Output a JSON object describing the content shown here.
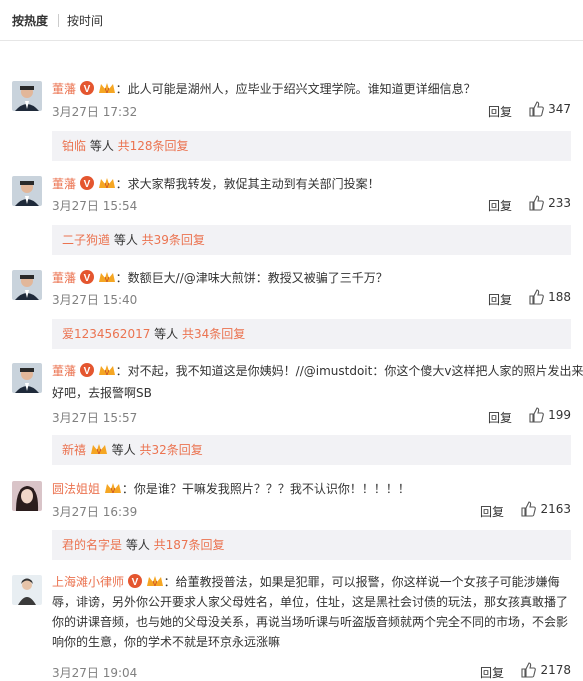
{
  "sort": {
    "hot": "按热度",
    "time": "按时间"
  },
  "comments": [
    {
      "user": "董藩",
      "text": "：此人可能是湖州人，应毕业于绍兴文理学院。谁知道更详细信息？",
      "time": "3月27日 17:32",
      "reply": "回复",
      "likes": "347",
      "sub": {
        "user": "铂临",
        "mid": " 等人 ",
        "count": "共128条回复"
      }
    },
    {
      "user": "董藩",
      "text": "：求大家帮我转发，敦促其主动到有关部门投案！",
      "time": "3月27日 15:54",
      "reply": "回复",
      "likes": "233",
      "sub": {
        "user": "二子狗遒",
        "mid": " 等人 ",
        "count": "共39条回复"
      }
    },
    {
      "user": "董藩",
      "text": "：数额巨大//@津味大煎饼：教授又被骗了三千万？",
      "time": "3月27日 15:40",
      "reply": "回复",
      "likes": "188",
      "sub": {
        "user": "爱1234562017",
        "mid": " 等人 ",
        "count": "共34条回复"
      }
    },
    {
      "user": "董藩",
      "text": "：对不起，我不知道这是你姨妈！//@imustdoit：你这个傻大v这样把人家的照片发出来不",
      "text2": "好吧，去报警啊SB",
      "time": "3月27日 15:57",
      "reply": "回复",
      "likes": "199",
      "sub": {
        "user": "新禧",
        "mid": " 等人 ",
        "count": "共32条回复"
      }
    },
    {
      "user": "圆法姐姐",
      "text": "：你是谁？干嘛发我照片？？？我不认识你！！！！！",
      "time": "3月27日 16:39",
      "reply": "回复",
      "likes": "2163",
      "sub": {
        "user": "君的名字是",
        "mid": " 等人 ",
        "count": "共187条回复"
      }
    },
    {
      "user": "上海滩小律师",
      "text": "：给董教授普法，如果是犯罪，可以报警，你这样说一个女孩子可能涉嫌侮",
      "lines": [
        "辱，诽谤，另外你公开要求人家父母姓名，单位，住址，这是黑社会讨债的玩法，那女孩真敢播了",
        "你的讲课音频，也与她的父母没关系，再说当场听课与听盗版音频就两个完全不同的市场，不会影",
        "响你的生意，你的学术不就是环京永远涨嘛"
      ],
      "time": "3月27日 19:04",
      "reply": "回复",
      "likes": "2178"
    }
  ],
  "colors": {
    "username": "#eb7350",
    "subbg": "#f2f2f5",
    "meta": "#808080"
  }
}
